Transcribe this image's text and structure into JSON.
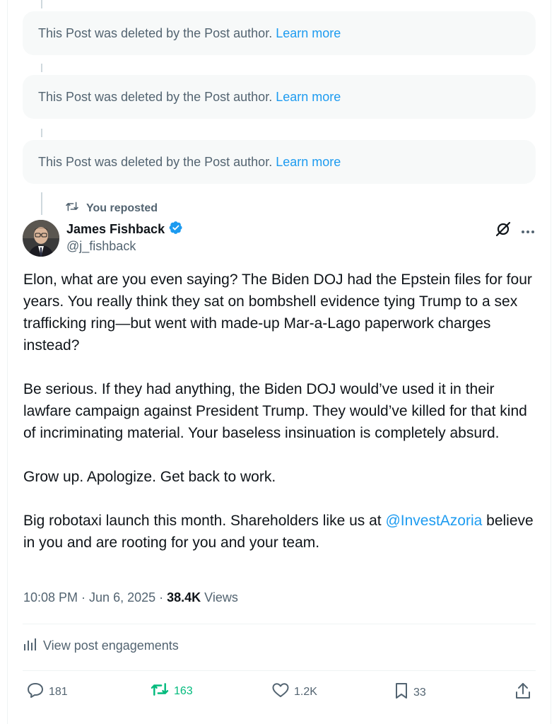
{
  "deleted_posts": [
    {
      "text": "This Post was deleted by the Post author.",
      "link": "Learn more"
    },
    {
      "text": "This Post was deleted by the Post author.",
      "link": "Learn more"
    },
    {
      "text": "This Post was deleted by the Post author.",
      "link": "Learn more"
    }
  ],
  "repost_label": "You reposted",
  "author": {
    "name": "James Fishback",
    "handle": "@j_fishback",
    "verified": true
  },
  "post": {
    "paragraphs": [
      "Elon, what are you even saying? The Biden DOJ had the Epstein files for four years. You really think they sat on bombshell evidence tying Trump to a sex trafficking ring—but went with made-up Mar-a-Lago paperwork charges instead?",
      "Be serious. If they had anything, the Biden DOJ would’ve used it in their lawfare campaign against President Trump. They would’ve killed for that kind of incriminating material. Your baseless insinuation is completely absurd.",
      "Grow up. Apologize. Get back to work."
    ],
    "last_paragraph_before": "Big robotaxi launch this month. Shareholders like us at ",
    "mention": "@InvestAzoria",
    "last_paragraph_after": " believe in you and are rooting for you and your team."
  },
  "meta": {
    "time": "10:08 PM · Jun 6, 2025 · ",
    "views_count": "38.4K",
    "views_label": " Views"
  },
  "engagements_label": "View post engagements",
  "actions": {
    "replies": "181",
    "reposts": "163",
    "likes": "1.2K",
    "bookmarks": "33"
  },
  "colors": {
    "accent": "#1d9bf0",
    "repost_active": "#00ba7c",
    "muted": "#536471"
  },
  "icons": [
    "repost-icon",
    "verified-badge-icon",
    "grok-icon",
    "more-icon",
    "analytics-icon",
    "reply-icon",
    "like-icon",
    "bookmark-icon",
    "share-icon"
  ]
}
